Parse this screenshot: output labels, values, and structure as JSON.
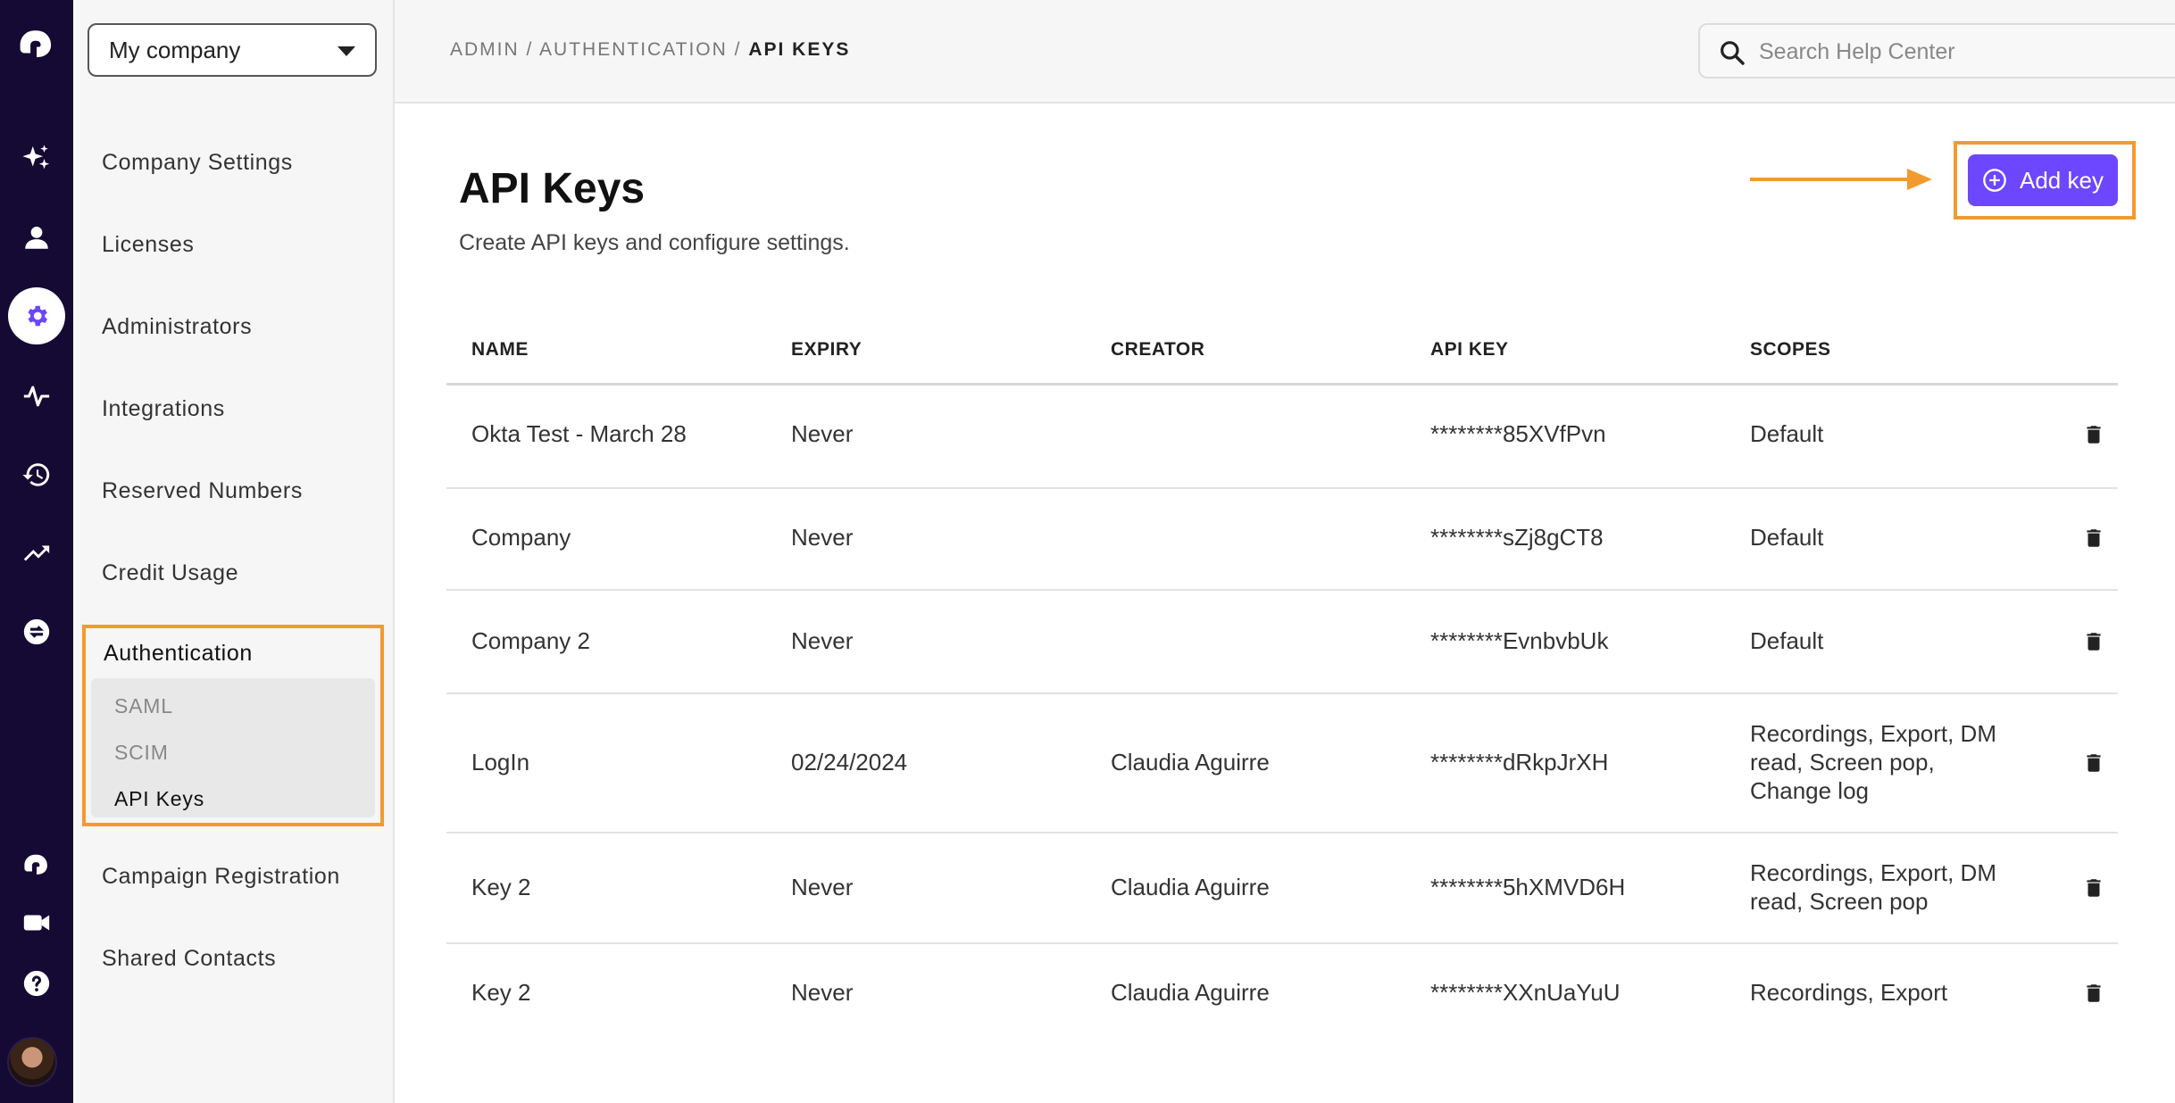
{
  "company_select": {
    "value": "My company"
  },
  "nav": {
    "items": [
      "Company Settings",
      "Licenses",
      "Administrators",
      "Integrations",
      "Reserved Numbers",
      "Credit Usage"
    ],
    "auth": {
      "title": "Authentication",
      "sub": [
        "SAML",
        "SCIM",
        "API Keys"
      ]
    },
    "bottom": [
      "Campaign Registration",
      "Shared Contacts"
    ]
  },
  "breadcrumb": {
    "admin": "ADMIN",
    "sep": " / ",
    "auth": "AUTHENTICATION",
    "current": "API KEYS"
  },
  "search": {
    "placeholder": "Search Help Center"
  },
  "page": {
    "title": "API Keys",
    "subtitle": "Create API keys and configure settings."
  },
  "add_button": {
    "label": "Add key"
  },
  "table": {
    "headers": [
      "NAME",
      "EXPIRY",
      "CREATOR",
      "API KEY",
      "SCOPES"
    ],
    "rows": [
      {
        "name": "Okta Test - March 28",
        "expiry": "Never",
        "creator": "",
        "key": "********85XVfPvn",
        "scopes": "Default"
      },
      {
        "name": "Company",
        "expiry": "Never",
        "creator": "",
        "key": "********sZj8gCT8",
        "scopes": "Default"
      },
      {
        "name": "Company 2",
        "expiry": "Never",
        "creator": "",
        "key": "********EvnbvbUk",
        "scopes": "Default"
      },
      {
        "name": "LogIn",
        "expiry": "02/24/2024",
        "creator": "Claudia Aguirre",
        "key": "********dRkpJrXH",
        "scopes": "Recordings, Export, DM read, Screen pop, Change log"
      },
      {
        "name": "Key 2",
        "expiry": "Never",
        "creator": "Claudia Aguirre",
        "key": "********5hXMVD6H",
        "scopes": "Recordings, Export, DM read, Screen pop"
      },
      {
        "name": "Key 2",
        "expiry": "Never",
        "creator": "Claudia Aguirre",
        "key": "********XXnUaYuU",
        "scopes": "Recordings, Export"
      }
    ]
  },
  "colors": {
    "rail": "#140a33",
    "accent": "#6c47ff",
    "highlight": "#f39a2d"
  },
  "icons": [
    "logo-icon",
    "sparkle-icon",
    "person-icon",
    "gear-icon",
    "pulse-icon",
    "history-icon",
    "trending-icon",
    "sync-icon",
    "logo-small-icon",
    "video-icon",
    "help-icon",
    "search-icon",
    "plus-circle-icon",
    "trash-icon"
  ]
}
